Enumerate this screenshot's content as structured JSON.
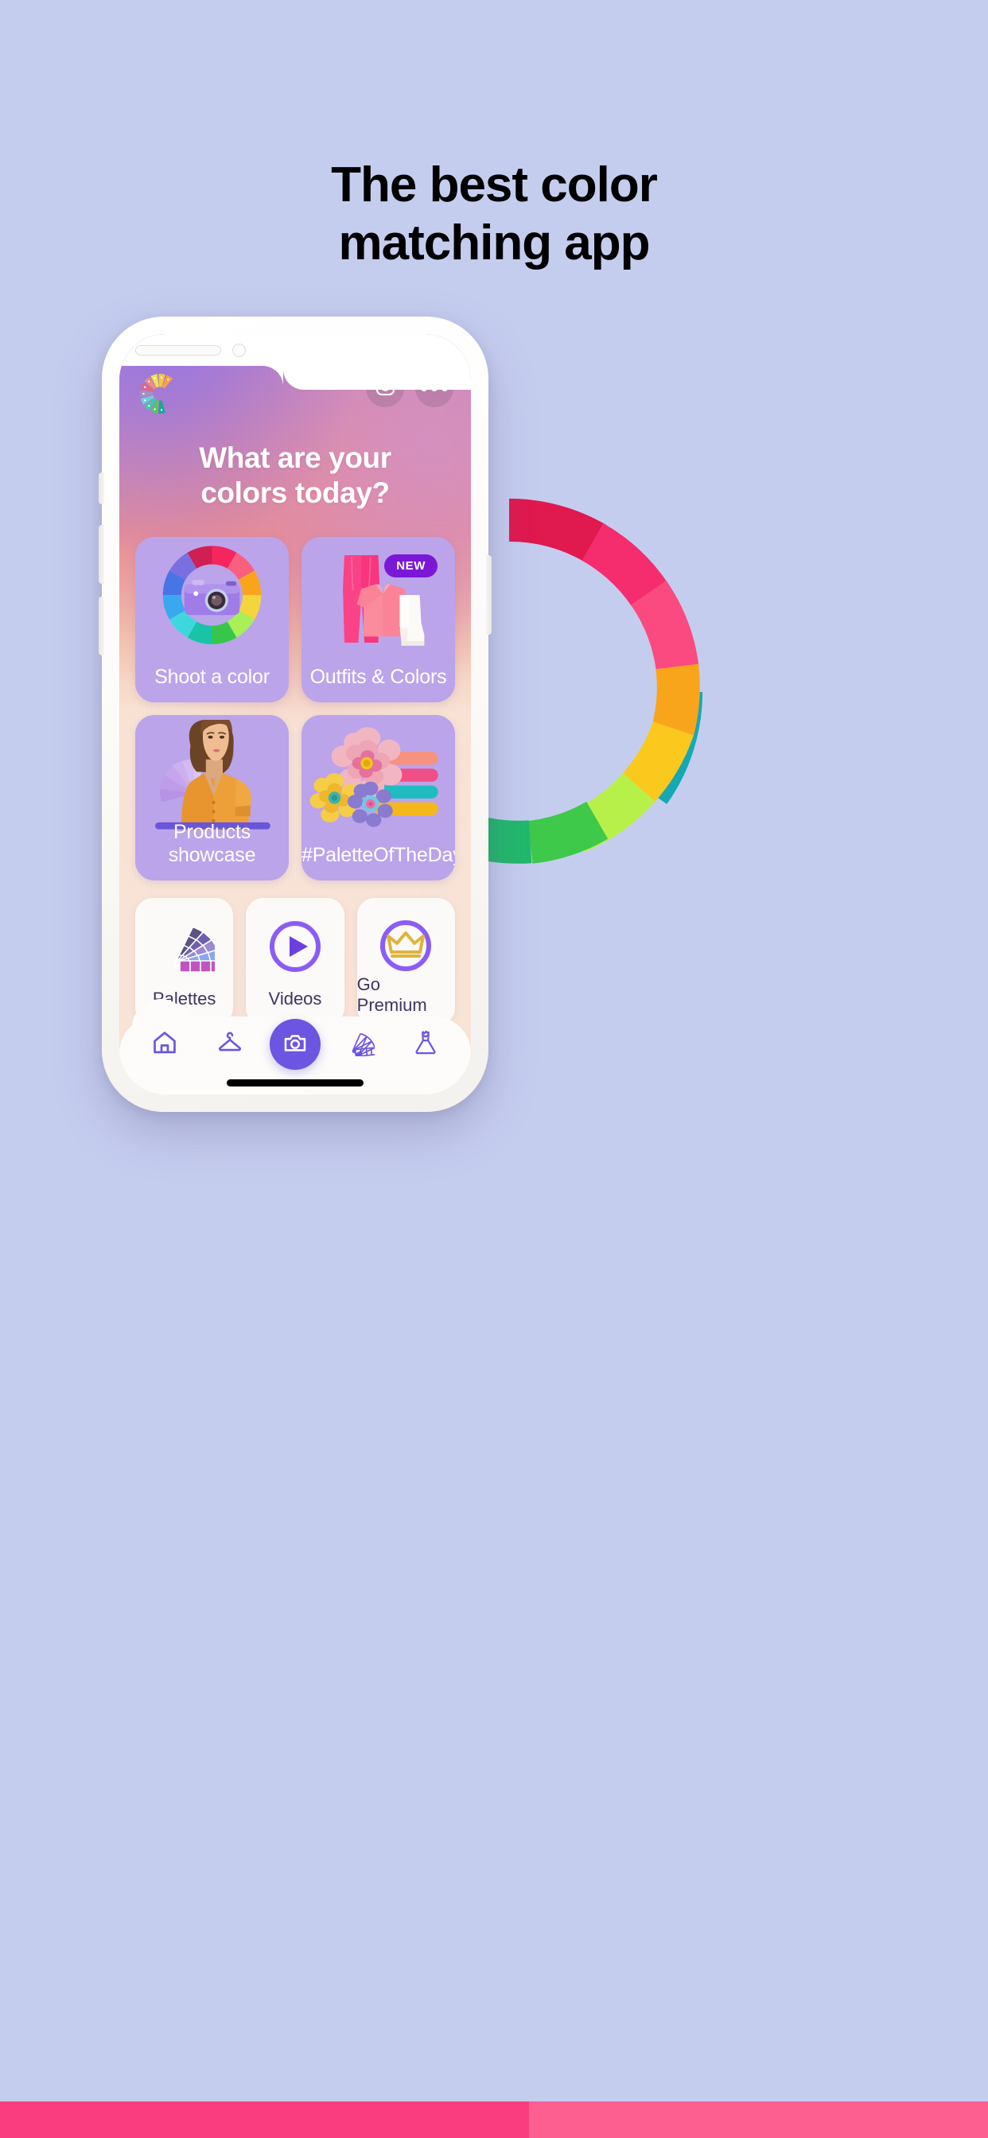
{
  "page": {
    "background_color": "#c5cdef",
    "headline_line1": "The best color",
    "headline_line2": "matching app"
  },
  "bottom_strip": {
    "left_color": "#fa3d7e",
    "right_color": "#fc5f90"
  },
  "color_wheel": {
    "name": "color-wheel-arc",
    "segments": [
      "#e0194f",
      "#f52d6e",
      "#fb4a7f",
      "#f9a51b",
      "#fbc81e",
      "#e9e81f",
      "#b8f04a",
      "#7ce34a",
      "#3ec94b",
      "#21b96c",
      "#1ab49a",
      "#16a8b4"
    ]
  },
  "phone": {
    "frame_color": "#ffffff",
    "home_indicator": true
  },
  "app": {
    "logo": {
      "name": "app-logo-color-c",
      "colors": [
        "#f6a04a",
        "#f6c843",
        "#f4e04a",
        "#e8746f",
        "#d96a84",
        "#b08ab8",
        "#7fd1cf",
        "#4ec3b0",
        "#5fc36a",
        "#2fae9b"
      ]
    },
    "actions": [
      {
        "name": "instagram-button",
        "icon": "instagram-icon",
        "label": "Instagram"
      },
      {
        "name": "more-button",
        "icon": "more-dots-icon",
        "label": "More"
      }
    ],
    "title_line1": "What are your",
    "title_line2": "colors today?",
    "cards": [
      {
        "id": "shoot-a-color",
        "label": "Shoot a color",
        "art": "camera-color-wheel",
        "badge": null,
        "bg": "#bba4ea"
      },
      {
        "id": "outfits-and-colors",
        "label": "Outfits & Colors",
        "art": "outfit-pink-pants-top-boot",
        "badge": "NEW",
        "badge_color": "#7b17d6",
        "bg": "#bba4ea"
      },
      {
        "id": "products-showcase",
        "label": "Products showcase",
        "art": "woman-orange-dress-fan",
        "badge": null,
        "bg": "#bba4ea"
      },
      {
        "id": "palette-of-the-day",
        "label": "#PaletteOfTheDay",
        "art": "paper-flowers-color-bars",
        "badge": null,
        "bg": "#bba4ea",
        "bar_colors": [
          "#f7927f",
          "#ef4f86",
          "#1fbdc0",
          "#f5b81c"
        ]
      }
    ],
    "shortcuts": [
      {
        "id": "palettes",
        "label": "Palettes",
        "art": "palette-fan-icon"
      },
      {
        "id": "videos",
        "label": "Videos",
        "art": "play-circle-icon"
      },
      {
        "id": "go-premium",
        "label": "Go Premium",
        "art": "crown-circle-icon"
      }
    ],
    "nav": [
      {
        "id": "home",
        "icon": "home-icon",
        "active": true
      },
      {
        "id": "wardrobe",
        "icon": "hanger-icon",
        "active": false
      },
      {
        "id": "camera",
        "icon": "camera-icon",
        "active": false,
        "fab": true
      },
      {
        "id": "palettes",
        "icon": "palette-fan-icon",
        "active": false
      },
      {
        "id": "outfits",
        "icon": "dress-icon",
        "active": false
      }
    ],
    "accent_color": "#6c55e0"
  }
}
